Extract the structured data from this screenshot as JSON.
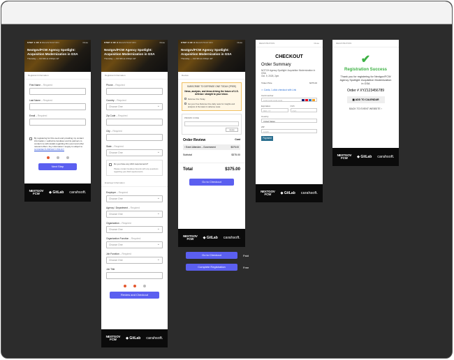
{
  "brand": {
    "footer_logo_1": "NEXTGOV\nFCW",
    "footer_logo_2": "GitLab",
    "footer_logo_3": "carahsoft.",
    "accent": "#5b5ff0",
    "success": "#3cb043",
    "dot_active": "#e4572e"
  },
  "event": {
    "title": "Nextgov/FCW Agency Spotlight: Acquisition Modernization in GSA",
    "date": "Thursday — Oct 9th at 2:00pm ET"
  },
  "screen1": {
    "step": "STEP 1 OF 3",
    "step_sub": "REGISTRATION",
    "close": "Close",
    "section": "Registrant Information",
    "fields": [
      {
        "label": "First Name",
        "req": "– Required"
      },
      {
        "label": "Last Name",
        "req": "– Required"
      },
      {
        "label": "Email",
        "req": "– Required"
      }
    ],
    "consent": "By registering for this event and providing my contact information, I authorize GovExec and its partners to contact me with details regarding this event and other relevant offers. Any information I supply is subject to",
    "consent_link": "GOVEXEC'S PRIVACY POLICY",
    "next": "Next Step"
  },
  "screen2": {
    "step": "STEP 2 OF 3",
    "step_sub": "REGISTRATION",
    "close": "Close",
    "section": "Registrant Information",
    "phone": {
      "label": "Phone",
      "req": "– Required"
    },
    "country": {
      "label": "Country",
      "req": "– Required",
      "value": "Choose One"
    },
    "zip": {
      "label": "Zip Code",
      "req": "– Required"
    },
    "city": {
      "label": "City",
      "req": "– Required"
    },
    "state": {
      "label": "State",
      "req": "– Required",
      "value": "Choose One"
    },
    "ada": "Do you have any ADA requirements?",
    "ada_sub": "Please contact GovExec Events with any questions regarding your ADA requirements.",
    "section2": "Employer Information",
    "employer": {
      "label": "Employer",
      "req": "– Required",
      "value": "Choose One"
    },
    "agency": {
      "label": "Agency / Department",
      "req": "– Required",
      "value": "Choose One"
    },
    "organization": {
      "label": "Organization",
      "req": "– Required",
      "value": "Choose One"
    },
    "org_function": {
      "label": "Organization Function",
      "req": "– Required",
      "value": "Choose One"
    },
    "job_function": {
      "label": "Job Function",
      "req": "– Required",
      "value": "Choose One"
    },
    "job_title": {
      "label": "Job Title"
    },
    "review": "Review and Checkout"
  },
  "screen3": {
    "step": "STEP 3 OF 3",
    "step_sub": "REGISTRATION",
    "close": "Close",
    "section": "Review",
    "promo_head": "SUBSCRIBE TO DEFENSE ONE TODAY (FREE)",
    "promo_text": "News, analysis, and ideas driving the future of U.S. defense: straight to your inbox.",
    "promo_opt1": "Defense One Today",
    "promo_opt2": "Get your free Defense One daily news for insights and analysis of the latest in defense news",
    "promo_code": "PROMO CODE",
    "apply": "Apply",
    "order_review": "Order Review",
    "cost": "Cost",
    "item": "Event Attendee – Government",
    "item_price": "$375.00",
    "subtotal_label": "Subtotal",
    "subtotal": "$375.00",
    "total_label": "Total",
    "total": "$375.00",
    "go": "Go to Checkout"
  },
  "screen4": {
    "header": "REGISTRATION",
    "close": "Close",
    "title": "CHECKOUT",
    "summary": "Order Summary",
    "event": "NOTCH Agency Spotlight: Acquisition Modernization in GSA",
    "event_date": "Oct. 9, 2025, 2pm",
    "price_label": "Ticket Price",
    "price": "$375.00",
    "card_toggle": "Cards, 1-click checkout with Link",
    "card_number": "Card number",
    "card_ph": "1234 1234 1234 1234",
    "expiration": "Expiration",
    "exp_ph": "MM / YY",
    "cvc": "CVC",
    "cvc_ph": "CVC",
    "country": "Country",
    "country_val": "United States",
    "zip": "ZIP",
    "zip_ph": "12345",
    "pay": "Payment"
  },
  "screen5": {
    "header": "REGISTRATION",
    "success": "Registration Success",
    "thanks": "Thank you for registering for Nextgov/FCW Agency Spotlight: Acquisition Modernization in GSA",
    "order": "Order # XYZ123456789",
    "calendar": "ADD TO CALENDAR",
    "back": "BACK TO EVENT WEBSITE"
  },
  "annotations": {
    "btn1": "Go to Checkout",
    "btn1_lbl": "Paid",
    "btn2": "Complete Registration",
    "btn2_lbl": "Free"
  }
}
